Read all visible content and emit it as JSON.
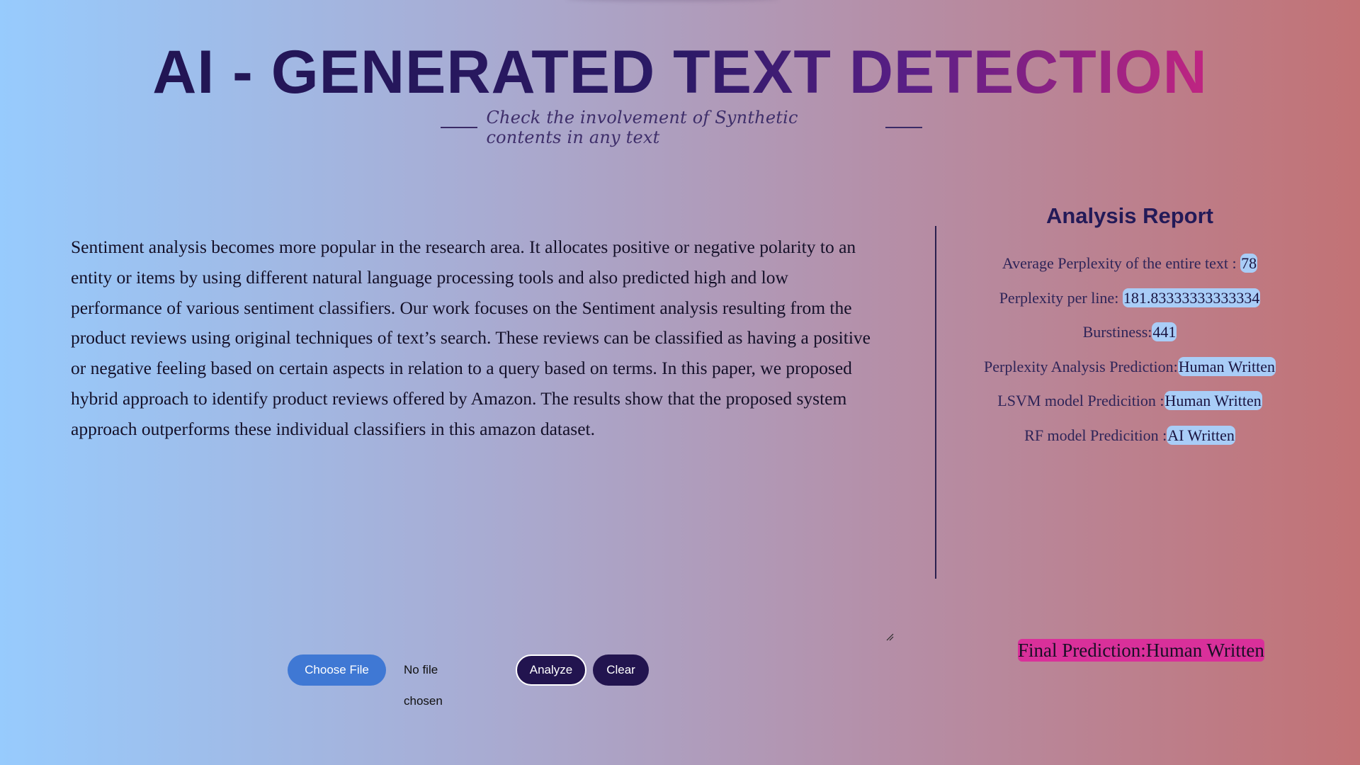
{
  "header": {
    "title": "AI - GENERATED TEXT DETECTION",
    "subtitle": "Check the involvement of Synthetic contents in any text"
  },
  "input_text": "Sentiment analysis becomes more popular in the research area. It allocates positive or negative polarity to an entity or items by using different natural language processing tools and also predicted high and low performance of various sentiment classifiers. Our work focuses on the Sentiment analysis resulting from the product reviews using original techniques of text’s search. These reviews can be classified as having a positive or negative feeling based on certain aspects in relation to a query based on terms. In this paper, we proposed hybrid approach to identify product reviews offered by Amazon. The results show that the proposed system approach outperforms these individual classifiers in this amazon dataset.",
  "report": {
    "heading": "Analysis Report",
    "items": [
      {
        "label": "Average Perplexity of the entire text : ",
        "value": "78"
      },
      {
        "label": "Perplexity per line: ",
        "value": "181.83333333333334"
      },
      {
        "label": "Burstiness:",
        "value": "441"
      },
      {
        "label": "Perplexity Analysis Prediction:",
        "value": "Human Written"
      },
      {
        "label": "LSVM model Predicition :",
        "value": "Human Written"
      },
      {
        "label": "RF model Predicition :",
        "value": "AI Written"
      }
    ]
  },
  "final_prediction": "Final Prediction:Human Written",
  "controls": {
    "choose_file": "Choose File",
    "no_file": "No file chosen",
    "analyze": "Analyze",
    "clear": "Clear"
  },
  "colors": {
    "accent_dark": "#22144f",
    "choose_button": "#3f78d4",
    "value_highlight": "#a9cdf7",
    "final_highlight": "#d9309a"
  }
}
